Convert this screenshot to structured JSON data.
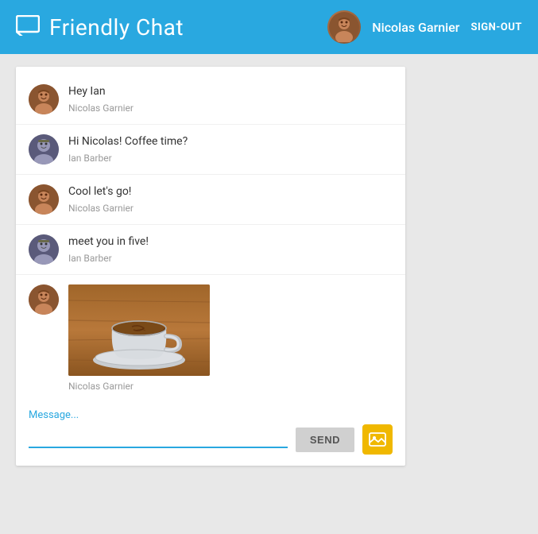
{
  "header": {
    "title": "Friendly Chat",
    "username": "Nicolas Garnier",
    "signout_label": "SIGN-OUT"
  },
  "messages": [
    {
      "id": 1,
      "text": "Hey Ian",
      "sender": "Nicolas Garnier",
      "avatar_type": "nicolas"
    },
    {
      "id": 2,
      "text": "Hi Nicolas! Coffee time?",
      "sender": "Ian Barber",
      "avatar_type": "ian"
    },
    {
      "id": 3,
      "text": "Cool let's go!",
      "sender": "Nicolas Garnier",
      "avatar_type": "nicolas"
    },
    {
      "id": 4,
      "text": "meet you in five!",
      "sender": "Ian Barber",
      "avatar_type": "ian"
    },
    {
      "id": 5,
      "text": "",
      "sender": "Nicolas Garnier",
      "avatar_type": "nicolas",
      "has_image": true
    }
  ],
  "input": {
    "placeholder": "Message...",
    "send_label": "SEND"
  }
}
